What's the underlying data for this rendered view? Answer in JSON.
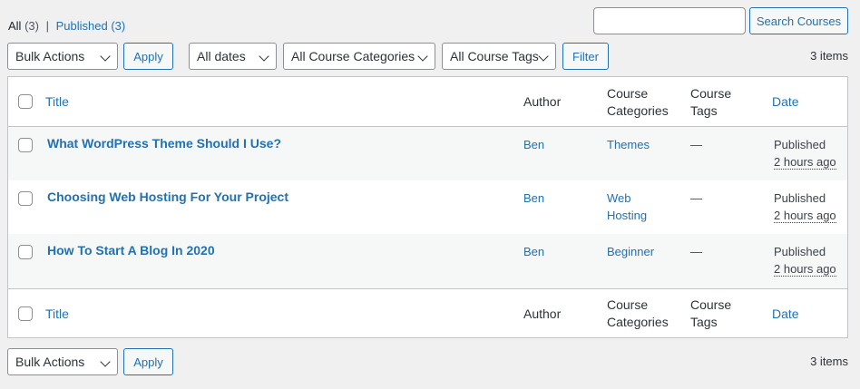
{
  "filters": {
    "all_label": "All",
    "all_count": "(3)",
    "separator": "|",
    "published_label": "Published",
    "published_count": "(3)"
  },
  "search": {
    "value": "",
    "placeholder": "",
    "button_label": "Search Courses"
  },
  "toolbar_top": {
    "bulk_actions": "Bulk Actions",
    "apply_label": "Apply",
    "dates": "All dates",
    "categories": "All Course Categories",
    "tags": "All Course Tags",
    "filter_label": "Filter",
    "items_count": "3 items"
  },
  "table": {
    "columns": {
      "title": "Title",
      "author": "Author",
      "categories_line1": "Course",
      "categories_line2": "Categories",
      "tags_line1": "Course",
      "tags_line2": "Tags",
      "date": "Date"
    },
    "rows": [
      {
        "title": "What WordPress Theme Should I Use?",
        "author": "Ben",
        "category_line1": "Themes",
        "category_line2": "",
        "tags": "—",
        "status": "Published",
        "when": "2 hours ago"
      },
      {
        "title": "Choosing Web Hosting For Your Project",
        "author": "Ben",
        "category_line1": "Web",
        "category_line2": "Hosting",
        "tags": "—",
        "status": "Published",
        "when": "2 hours ago"
      },
      {
        "title": "How To Start A Blog In 2020",
        "author": "Ben",
        "category_line1": "Beginner",
        "category_line2": "",
        "tags": "—",
        "status": "Published",
        "when": "2 hours ago"
      }
    ]
  },
  "toolbar_bottom": {
    "bulk_actions": "Bulk Actions",
    "apply_label": "Apply",
    "items_count": "3 items"
  },
  "icons": {
    "dropdown": "chevron-down-icon"
  },
  "colors": {
    "link": "#2271b1",
    "background": "#f0f0f1",
    "border": "#c3c4c7"
  }
}
